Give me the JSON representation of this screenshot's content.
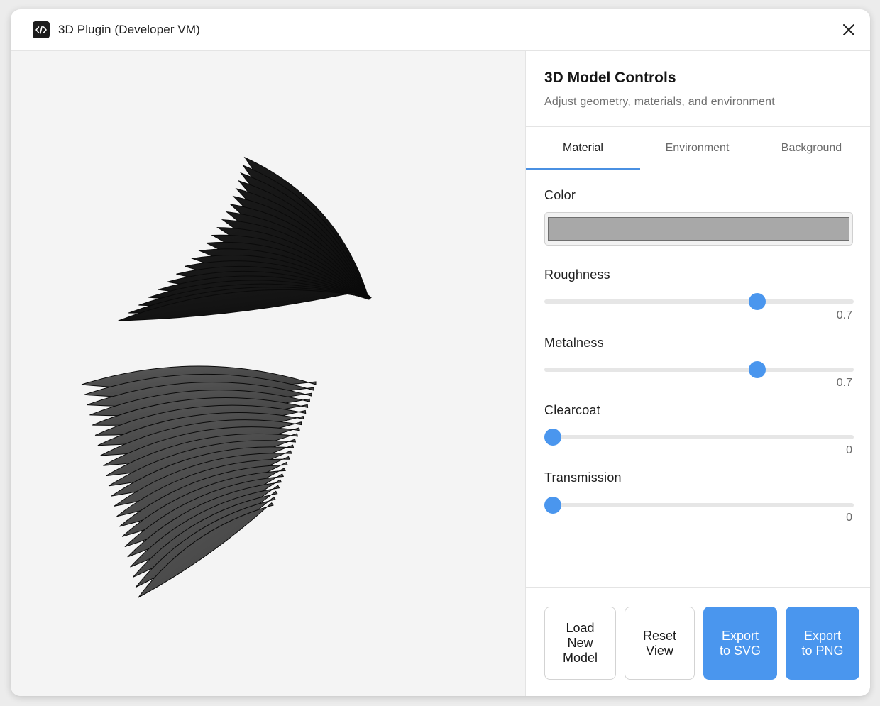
{
  "window": {
    "title": "3D Plugin (Developer VM)",
    "app_icon": "code-icon",
    "close_icon": "close-icon"
  },
  "viewport": {
    "model_color": "#2e2e2e",
    "background": "#f4f4f4"
  },
  "panel": {
    "title": "3D Model Controls",
    "subtitle": "Adjust geometry, materials, and environment",
    "tabs": [
      {
        "label": "Material",
        "active": true
      },
      {
        "label": "Environment",
        "active": false
      },
      {
        "label": "Background",
        "active": false
      }
    ],
    "color": {
      "label": "Color",
      "value": "#a8a8a8"
    },
    "sliders": [
      {
        "label": "Roughness",
        "value": "0.7",
        "fraction": 0.7
      },
      {
        "label": "Metalness",
        "value": "0.7",
        "fraction": 0.7
      },
      {
        "label": "Clearcoat",
        "value": "0",
        "fraction": 0
      },
      {
        "label": "Transmission",
        "value": "0",
        "fraction": 0
      }
    ],
    "buttons": {
      "load": "Load New Model",
      "reset": "Reset View",
      "export_svg": "Export to SVG",
      "export_png": "Export to PNG"
    }
  },
  "colors": {
    "accent": "#4a96ee",
    "tab_indicator": "#4a90e2"
  }
}
